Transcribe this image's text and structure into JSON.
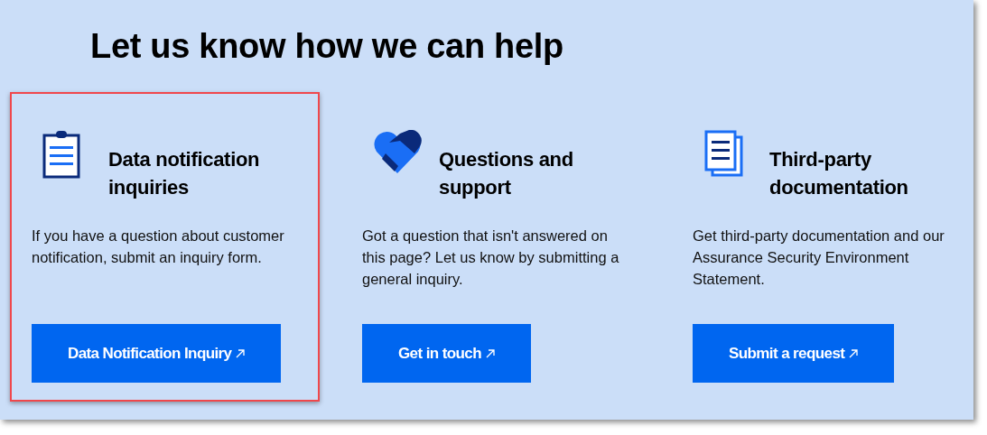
{
  "heading": "Let us know how we can help",
  "cards": [
    {
      "kind": "clipboard",
      "title": "Data notification inquiries",
      "description": "If you have a question about customer notification, submit an inquiry form.",
      "button": "Data Notification Inquiry",
      "highlighted": true
    },
    {
      "kind": "handshake",
      "title": "Questions and support",
      "description": "Got a question that isn't answered on this page? Let us know by submitting a general inquiry.",
      "button": "Get in touch",
      "highlighted": false
    },
    {
      "kind": "documents",
      "title": "Third-party documentation",
      "description": "Get third-party documentation and our Assurance Security Environment Statement.",
      "button": "Submit a request",
      "highlighted": false
    }
  ]
}
